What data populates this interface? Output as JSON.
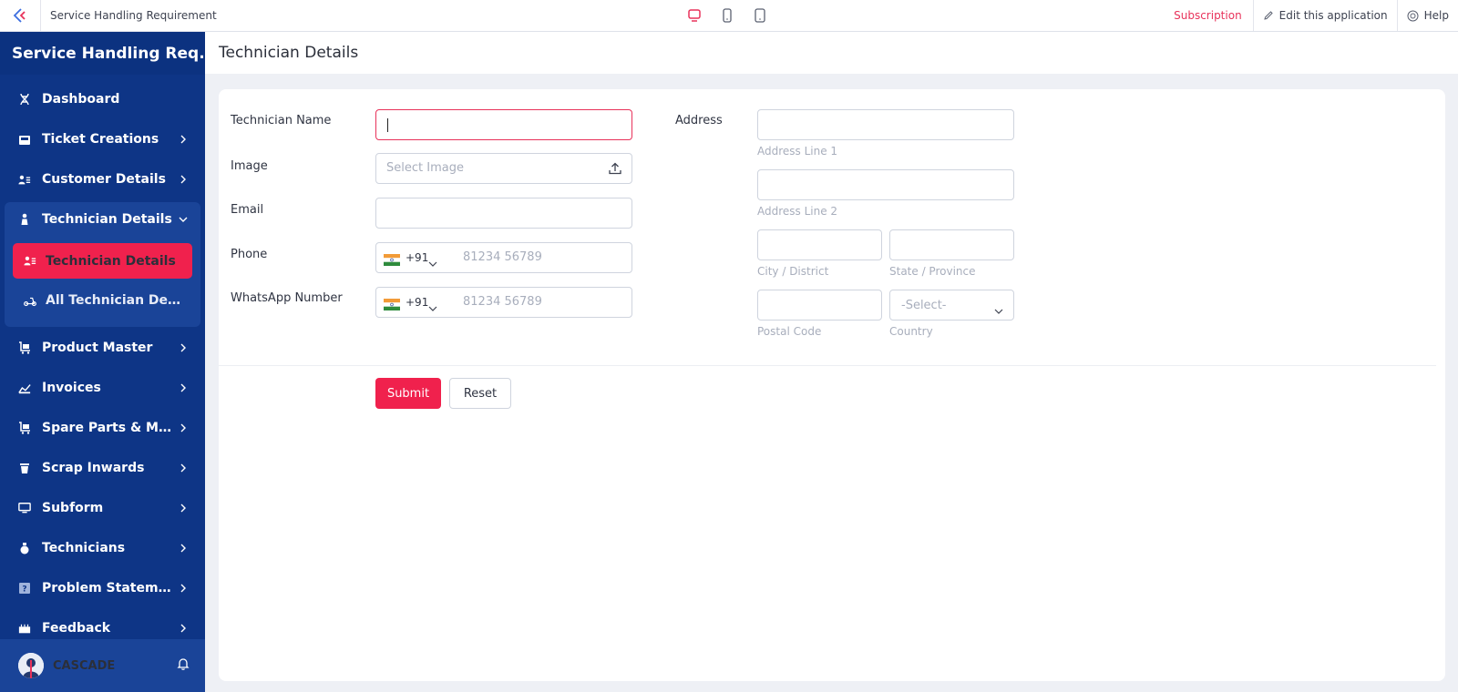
{
  "topbar": {
    "app_title": "Service Handling Requirement",
    "subscription": "Subscription",
    "edit_app": "Edit this application",
    "help": "Help"
  },
  "sidebar": {
    "app_name": "Service Handling Req...",
    "items": [
      {
        "label": "Dashboard",
        "icon": "dna-icon"
      },
      {
        "label": "Ticket Creations",
        "icon": "inbox-icon"
      },
      {
        "label": "Customer Details",
        "icon": "user-list-icon"
      },
      {
        "label": "Technician Details",
        "icon": "person-icon"
      },
      {
        "label": "Product Master",
        "icon": "cart-icon"
      },
      {
        "label": "Invoices",
        "icon": "invoice-icon"
      },
      {
        "label": "Spare Parts & Ma...",
        "icon": "cart-icon"
      },
      {
        "label": "Scrap Inwards",
        "icon": "bin-icon"
      },
      {
        "label": "Subform",
        "icon": "monitor-icon"
      },
      {
        "label": "Technicians",
        "icon": "flask-icon"
      },
      {
        "label": "Problem Stateme...",
        "icon": "question-icon"
      },
      {
        "label": "Feedback",
        "icon": "feedback-icon"
      }
    ],
    "sub_items": [
      {
        "label": "Technician Details",
        "active": true
      },
      {
        "label": "All Technician Det..."
      }
    ],
    "user": "CASCADE"
  },
  "page": {
    "title": "Technician Details"
  },
  "form": {
    "technician_name_label": "Technician Name",
    "image_label": "Image",
    "image_placeholder": "Select Image",
    "email_label": "Email",
    "phone_label": "Phone",
    "phone_code": "+91",
    "phone_placeholder": "81234 56789",
    "whatsapp_label": "WhatsApp Number",
    "whatsapp_code": "+91",
    "whatsapp_placeholder": "81234 56789",
    "address_label": "Address",
    "address_line1": "Address Line 1",
    "address_line2": "Address Line 2",
    "city": "City / District",
    "state": "State / Province",
    "postal": "Postal Code",
    "country": "Country",
    "country_select": "-Select-",
    "submit": "Submit",
    "reset": "Reset"
  },
  "colors": {
    "sidebar_bg": "#0e3586",
    "accent": "#f0214d"
  }
}
